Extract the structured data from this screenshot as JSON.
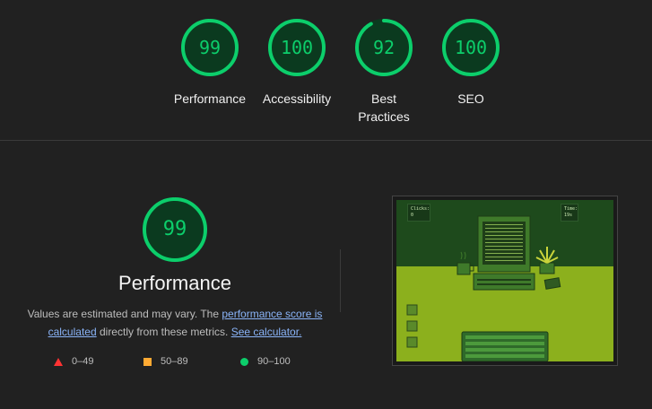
{
  "gauges": [
    {
      "score": "99",
      "label": "Performance",
      "fraction": 0.99
    },
    {
      "score": "100",
      "label": "Accessibility",
      "fraction": 1.0
    },
    {
      "score": "92",
      "label": "Best Practices",
      "fraction": 0.92
    },
    {
      "score": "100",
      "label": "SEO",
      "fraction": 1.0
    }
  ],
  "performance": {
    "score": "99",
    "fraction": 0.99,
    "title": "Performance",
    "desc_prefix": "Values are estimated and may vary. The ",
    "link_score": "performance score is calculated",
    "desc_middle": " directly from these metrics. ",
    "link_calculator": "See calculator."
  },
  "legend": [
    {
      "range": "0–49",
      "shape": "triangle",
      "color": "#ff3333"
    },
    {
      "range": "50–89",
      "shape": "square",
      "color": "#ffaa33"
    },
    {
      "range": "90–100",
      "shape": "circle",
      "color": "#0cce6b"
    }
  ],
  "screenshot": {
    "clicks_label": "Clicks:",
    "clicks_value": "0",
    "time_label": "Time:",
    "time_value": "19s"
  },
  "colors": {
    "pass": "#0cce6b",
    "pass_track": "#0b3a1f",
    "background": "#212121"
  }
}
